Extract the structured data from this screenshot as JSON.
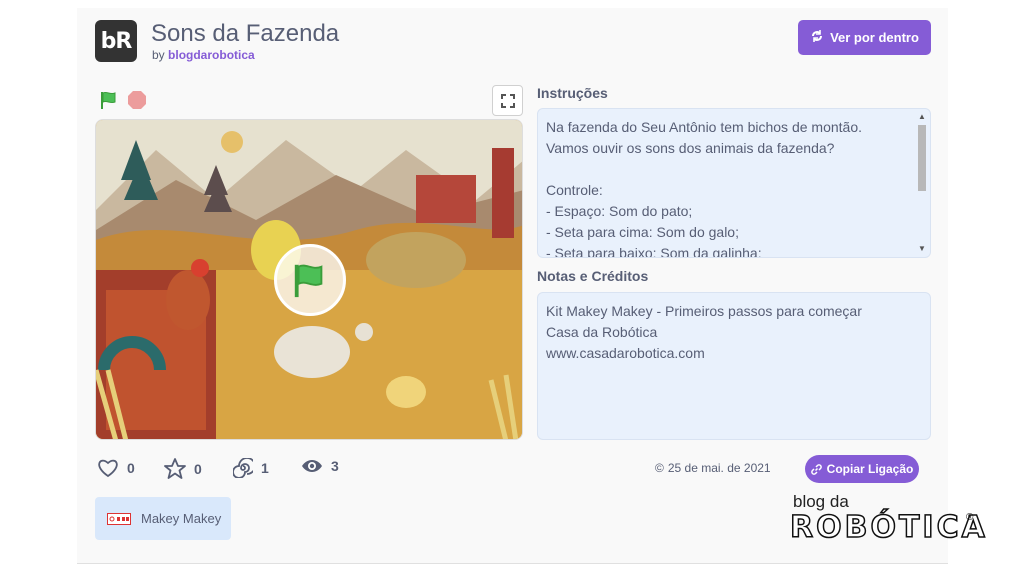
{
  "header": {
    "logo_text": "bR",
    "title": "Sons da Fazenda",
    "by_prefix": "by",
    "author": "blogdarobotica",
    "see_inside_label": "Ver por dentro"
  },
  "instructions": {
    "heading": "Instruções",
    "text": "Na fazenda do Seu Antônio tem bichos de montão.\nVamos ouvir os sons dos animais da fazenda?\n\nControle:\n- Espaço: Som do pato;\n- Seta para cima: Som do galo;\n- Seta para baixo: Som da galinha;"
  },
  "notes": {
    "heading": "Notas e Créditos",
    "text": "Kit Makey Makey - Primeiros passos para começar\nCasa da Robótica\nwww.casadarobotica.com"
  },
  "stats": {
    "loves": "0",
    "favorites": "0",
    "remixes": "1",
    "views": "3"
  },
  "date": "25 de mai. de 2021",
  "date_symbol": "©",
  "copy_link_label": "Copiar Ligação",
  "studio": {
    "label": "Makey Makey"
  },
  "watermark": {
    "top": "blog da",
    "main": "ROBÓTICA",
    "reg": "®"
  },
  "colors": {
    "accent": "#855cd6",
    "text": "#575e75",
    "box": "#e9f1fc"
  }
}
